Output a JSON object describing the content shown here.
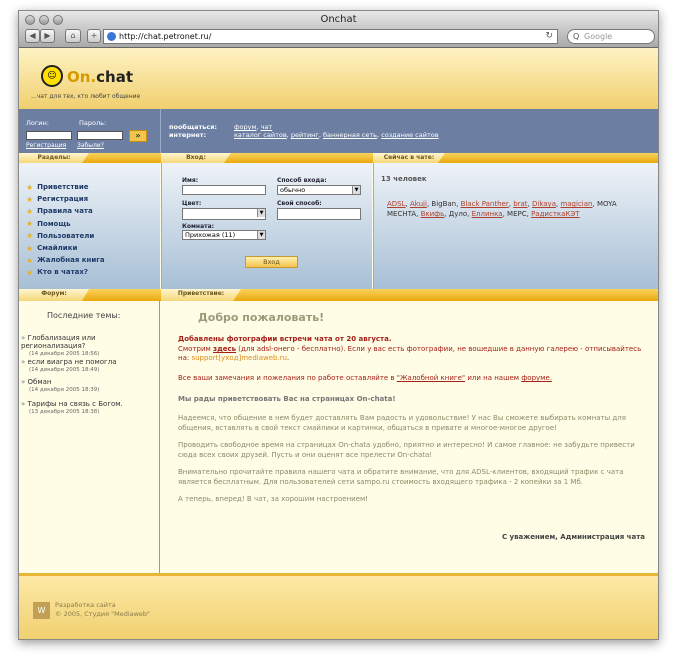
{
  "browser": {
    "title": "Onchat",
    "url": "http://chat.petronet.ru/",
    "search_placeholder": "Google"
  },
  "header": {
    "logo_on": "On.",
    "logo_chat": "chat",
    "slogan": "...чат для тех, кто любит общение"
  },
  "login": {
    "login_label": "Логин:",
    "password_label": "Пароль:",
    "go": "»",
    "register": "Регистрация",
    "forgot": "Забыли?"
  },
  "links": {
    "talk_label": "пообщаться:",
    "talk": [
      "форум",
      "чат"
    ],
    "internet_label": "интернет:",
    "internet": [
      "каталог сайтов",
      "рейтинг",
      "баннерная сеть",
      "создание сайтов"
    ]
  },
  "sections": {
    "title": "Разделы:",
    "items": [
      "Приветствие",
      "Регистрация",
      "Правила чата",
      "Помощь",
      "Пользователи",
      "Смайлики",
      "Жалобная книга",
      "Кто в чатах?"
    ]
  },
  "entry": {
    "title": "Вход:",
    "name_label": "Имя:",
    "mode_label": "Способ входа:",
    "mode_value": "обычно",
    "color_label": "Цвет:",
    "own_label": "Свой способ:",
    "room_label": "Комната:",
    "room_value": "Прихожая (11)",
    "submit": "Вход"
  },
  "online": {
    "title": "Сейчас в чате:",
    "count": "13 человек",
    "users": [
      {
        "n": "ADSL",
        "l": true
      },
      {
        "n": "Akuji",
        "l": true
      },
      {
        "n": "BigBan",
        "l": false
      },
      {
        "n": "Black Panther",
        "l": true
      },
      {
        "n": "brat",
        "l": true
      },
      {
        "n": "Dikaya",
        "l": true
      },
      {
        "n": "magician",
        "l": true
      },
      {
        "n": "MOYA MECHTA",
        "l": false
      },
      {
        "n": "Вкифь",
        "l": true
      },
      {
        "n": "Дуло",
        "l": false
      },
      {
        "n": "Еллинка",
        "l": true
      },
      {
        "n": "МЕРС",
        "l": false
      },
      {
        "n": "РадисткаКЭТ",
        "l": true
      }
    ]
  },
  "forum": {
    "title": "Форум:",
    "heading": "Последние темы:",
    "topics": [
      {
        "t": "Глобализация или регионализация?",
        "d": "(14 декабря 2005 18:56)"
      },
      {
        "t": "если виагра не помогла",
        "d": "(14 декабря 2005 18:49)"
      },
      {
        "t": "Обман",
        "d": "(14 декабря 2005 18:39)"
      },
      {
        "t": "Тарифы на связь с Богом.",
        "d": "(13 декабря 2005 18:38)"
      }
    ]
  },
  "welcome": {
    "tab": "Приветствие:",
    "title": "Добро пожаловать!",
    "news_title": "Добавлены фотографии встречи чата от 20 августа.",
    "news_1": "Смотрим ",
    "news_link": "здесь",
    "news_2": " (для adsl-онего - бесплатно). Если у вас есть фотографии, не вошедшие в данную галерею - отписывайтесь на: ",
    "news_email": "support[уход]mediaweb.ru",
    "news_3": ".",
    "complaint_1": "Все ваши замечания и пожелания по работе оставляйте в ",
    "complaint_link": "\"Жалобной книге\"",
    "complaint_2": " или на нашем ",
    "complaint_link2": "форуме.",
    "greet": "Мы рады приветствовать Вас на страницах On-chata!",
    "p1": "Надеемся, что общение в нем будет доставлять Вам радость и удовольствие! У нас Вы сможете выбирать комнаты для общения, вставлять в свой текст смайлики и картинки, общаться в привате и многое-многое другое!",
    "p2": "Проводить свободное время на страницах On-chata удобно, приятно и интересно! И самое главное: не забудьте привести сюда всех своих друзей. Пусть и они оценят все прелести On-chata!",
    "p3": "Внимательно прочитайте правила нашего чата и обратите внимание, что для ADSL-клиентов, входящий трафик с чата является бесплатным. Для пользователей сети sampo.ru стоимость входящего трафика - 2 копейки за 1 Мб.",
    "p4": "А теперь, вперед! В чат, за хорошим настроением!",
    "sign": "С уважением, Администрация чата"
  },
  "footer": {
    "line1": "Разработка сайта",
    "line2": "© 2005, Студия \"Mediaweb\""
  }
}
